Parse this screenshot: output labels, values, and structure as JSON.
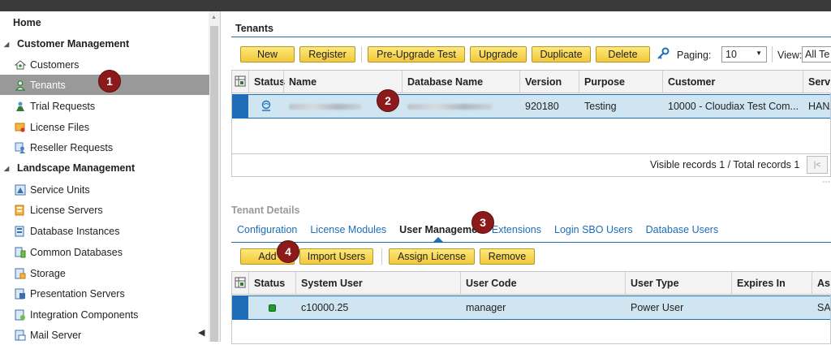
{
  "sidebar": {
    "home": "Home",
    "groups": [
      {
        "label": "Customer Management"
      },
      {
        "label": "Landscape Management"
      }
    ],
    "customer_items": [
      {
        "label": "Customers",
        "icon": "customers-icon"
      },
      {
        "label": "Tenants",
        "icon": "tenants-icon"
      },
      {
        "label": "Trial Requests",
        "icon": "trial-requests-icon"
      },
      {
        "label": "License Files",
        "icon": "license-files-icon"
      },
      {
        "label": "Reseller Requests",
        "icon": "reseller-requests-icon"
      }
    ],
    "landscape_items": [
      {
        "label": "Service Units",
        "icon": "service-units-icon"
      },
      {
        "label": "License Servers",
        "icon": "license-servers-icon"
      },
      {
        "label": "Database Instances",
        "icon": "database-instances-icon"
      },
      {
        "label": "Common Databases",
        "icon": "common-databases-icon"
      },
      {
        "label": "Storage",
        "icon": "storage-icon"
      },
      {
        "label": "Presentation Servers",
        "icon": "presentation-servers-icon"
      },
      {
        "label": "Integration Components",
        "icon": "integration-components-icon"
      },
      {
        "label": "Mail Server",
        "icon": "mail-server-icon"
      }
    ]
  },
  "markers": [
    "1",
    "2",
    "3",
    "4"
  ],
  "tenants": {
    "title": "Tenants",
    "buttons": [
      "New",
      "Register",
      "Pre-Upgrade Test",
      "Upgrade",
      "Duplicate",
      "Delete"
    ],
    "paging_label": "Paging:",
    "paging_value": "10",
    "view_label": "View:",
    "view_value": "All Te",
    "columns": [
      "Status",
      "Name",
      "Database Name",
      "Version",
      "Purpose",
      "Customer",
      "Servi"
    ],
    "row": {
      "version": "920180",
      "purpose": "Testing",
      "customer": "10000 - Cloudiax Test Com...",
      "service": "HANA"
    },
    "records_text": "Visible records 1 / Total records 1",
    "pager_first": "|<"
  },
  "details": {
    "title": "Tenant Details",
    "tabs": [
      "Configuration",
      "License Modules",
      "User Management",
      "Extensions",
      "Login SBO Users",
      "Database Users"
    ],
    "active_tab": 2,
    "buttons": [
      "Add",
      "Import Users",
      "Assign License",
      "Remove"
    ],
    "columns": [
      "Status",
      "System User",
      "User Code",
      "User Type",
      "Expires In",
      "As"
    ],
    "row": {
      "system_user": "c10000.25",
      "user_code": "manager",
      "user_type": "Power User",
      "expires": "",
      "assigned": "SA"
    }
  },
  "colors": {
    "accent": "#1e6db8",
    "button": "#f2c83a",
    "marker": "#8c1a1a",
    "selected_row": "#cfe6f2"
  }
}
